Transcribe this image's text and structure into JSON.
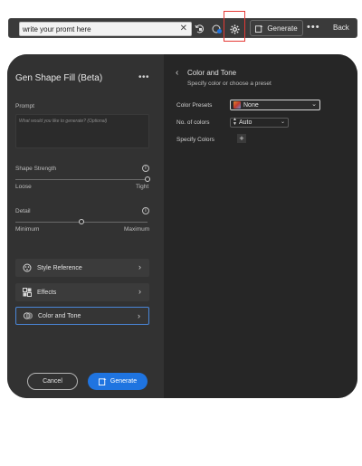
{
  "toolbar": {
    "prompt_value": "write your promt here",
    "clear_icon": "close-icon",
    "generate_label": "Generate",
    "more_label": "•••",
    "back_label": "Back"
  },
  "panel": {
    "title": "Gen Shape Fill (Beta)",
    "more_label": "•••",
    "prompt": {
      "label": "Prompt",
      "placeholder": "What would you like to generate? (Optional)"
    },
    "shape_strength": {
      "label": "Shape Strength",
      "min_label": "Loose",
      "max_label": "Tight",
      "value": 1.0
    },
    "detail": {
      "label": "Detail",
      "min_label": "Minimum",
      "max_label": "Maximum",
      "value": 0.5
    },
    "options": [
      {
        "label": "Style Reference",
        "icon": "style-reference-icon",
        "active": false
      },
      {
        "label": "Effects",
        "icon": "effects-icon",
        "active": false
      },
      {
        "label": "Color and Tone",
        "icon": "color-tone-icon",
        "active": true
      }
    ],
    "cancel_label": "Cancel",
    "generate_label": "Generate"
  },
  "color_tone": {
    "title": "Color and Tone",
    "subtitle": "Specify color or choose a preset",
    "presets_label": "Color Presets",
    "presets_value": "None",
    "count_label": "No. of colors",
    "count_value": "Auto",
    "specify_label": "Specify Colors",
    "add_label": "+"
  },
  "colors": {
    "accent": "#1f74e0",
    "highlight": "#e53935",
    "panel_left": "#323232",
    "panel_right": "#262626"
  }
}
